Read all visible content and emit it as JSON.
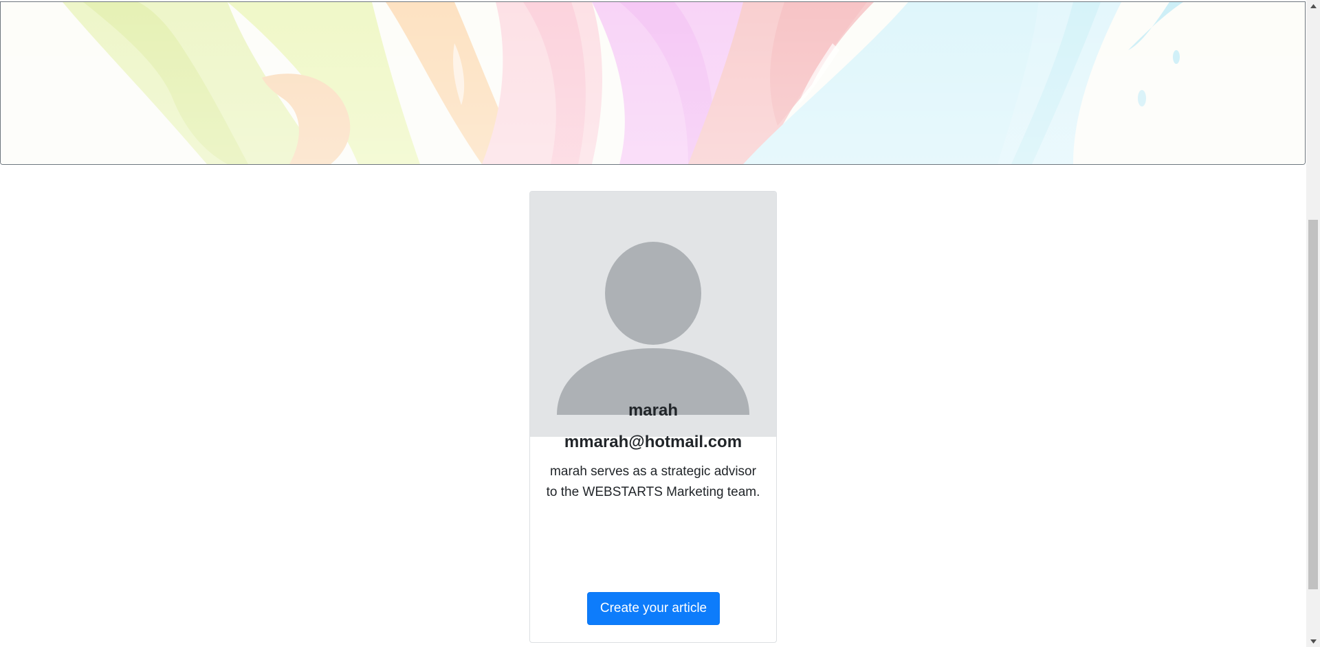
{
  "hero": {
    "image_name": "paint-splash-banner"
  },
  "profile": {
    "avatar_icon": "user-placeholder-icon",
    "name": "marah",
    "email": "mmarah@hotmail.com",
    "bio": "marah serves as a strategic advisor to the WEBSTARTS Marketing team.",
    "cta_label": "Create your article"
  },
  "colors": {
    "primary_button": "#0d7cfb",
    "avatar_background": "#e2e4e6",
    "avatar_silhouette": "#adb1b5"
  },
  "scrollbar": {
    "up_icon": "scroll-up-arrow-icon",
    "down_icon": "scroll-down-arrow-icon"
  }
}
